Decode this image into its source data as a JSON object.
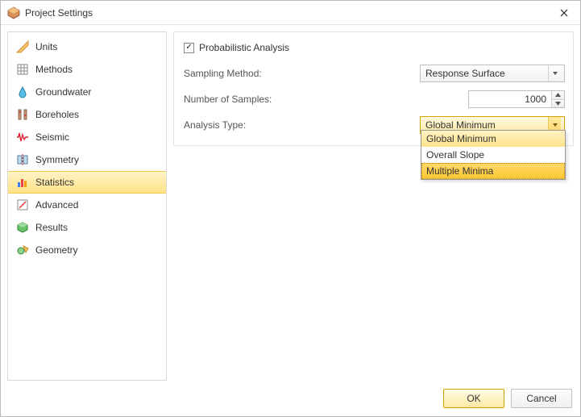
{
  "window": {
    "title": "Project Settings"
  },
  "sidebar": {
    "items": [
      {
        "label": "Units",
        "selected": false,
        "icon": "units"
      },
      {
        "label": "Methods",
        "selected": false,
        "icon": "methods"
      },
      {
        "label": "Groundwater",
        "selected": false,
        "icon": "groundwater"
      },
      {
        "label": "Boreholes",
        "selected": false,
        "icon": "boreholes"
      },
      {
        "label": "Seismic",
        "selected": false,
        "icon": "seismic"
      },
      {
        "label": "Symmetry",
        "selected": false,
        "icon": "symmetry"
      },
      {
        "label": "Statistics",
        "selected": true,
        "icon": "statistics"
      },
      {
        "label": "Advanced",
        "selected": false,
        "icon": "advanced"
      },
      {
        "label": "Results",
        "selected": false,
        "icon": "results"
      },
      {
        "label": "Geometry",
        "selected": false,
        "icon": "geometry"
      }
    ]
  },
  "panel": {
    "probabilistic_label": "Probabilistic Analysis",
    "probabilistic_checked": true,
    "sampling_label": "Sampling Method:",
    "sampling_value": "Response Surface",
    "samples_label": "Number of Samples:",
    "samples_value": "1000",
    "analysis_label": "Analysis Type:",
    "analysis_value": "Global Minimum",
    "analysis_options": [
      {
        "label": "Global Minimum",
        "state": "selected"
      },
      {
        "label": "Overall Slope",
        "state": "normal"
      },
      {
        "label": "Multiple Minima",
        "state": "hover"
      }
    ]
  },
  "footer": {
    "ok": "OK",
    "cancel": "Cancel"
  }
}
